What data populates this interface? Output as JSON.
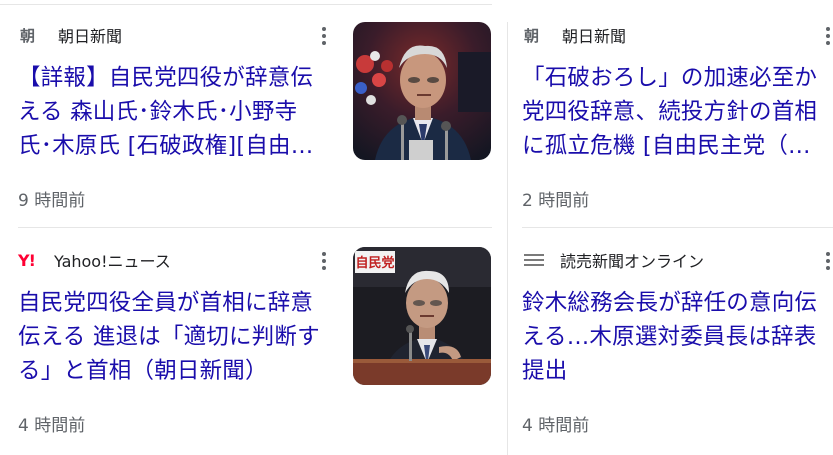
{
  "cards": [
    {
      "source": {
        "logo_text": "朝",
        "name": "朝日新聞"
      },
      "title_lines": [
        "【詳報】自民党四役が辞意伝",
        "える 森山氏･鈴木氏･小野寺",
        "氏･木原氏 [石破政権][自由…"
      ],
      "time": "9 時間前",
      "thumb": {
        "icon": "man-at-press-conference-photo"
      }
    },
    {
      "source": {
        "logo_text": "朝",
        "name": "朝日新聞"
      },
      "title_lines": [
        "「石破おろし」の加速必至か",
        "党四役辞意、続投方針の首相",
        "に孤立危機 [自由民主党（…"
      ],
      "time": "2 時間前"
    },
    {
      "source": {
        "logo_text": "Y!",
        "name": "Yahoo!ニュース"
      },
      "title_lines": [
        "自民党四役全員が首相に辞意",
        "伝える 進退は「適切に判断す",
        "る」と首相（朝日新聞）"
      ],
      "time": "4 時間前",
      "thumb": {
        "icon": "man-at-podium-photo",
        "sign_text": "自民党"
      }
    },
    {
      "source": {
        "logo_text": "",
        "name": "読売新聞オンライン"
      },
      "title_lines": [
        "鈴木総務会長が辞任の意向伝",
        "える…木原選対委員長は辞表",
        "提出"
      ],
      "time": "4 時間前"
    }
  ],
  "colors": {
    "link": "#1a0dab",
    "meta": "#5f6368",
    "yahoo": "#ff0033"
  }
}
